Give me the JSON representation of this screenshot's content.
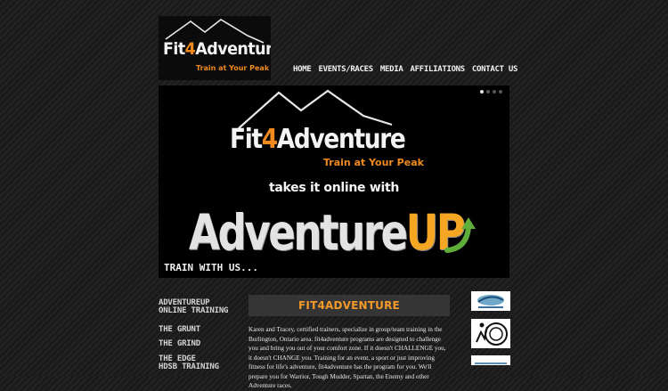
{
  "logo": {
    "part1": "Fit",
    "num": "4",
    "part2": "Adventure",
    "tagline": "Train at Your Peak"
  },
  "nav": [
    "HOME",
    "EVENTS/RACES",
    "MEDIA",
    "AFFILIATIONS",
    "CONTACT US"
  ],
  "banner": {
    "name_part1": "Fit",
    "name_num": "4",
    "name_part2": "Adventure",
    "tagline": "Train at Your Peak",
    "online_text": "takes it online with",
    "big_part1": "Adventure",
    "big_part2": "UP",
    "train_text": "TRAIN WITH US..."
  },
  "sidebar": [
    {
      "line1": "ADVENTUREUP",
      "line2": "ONLINE TRAINING"
    },
    {
      "line1": "THE GRUNT"
    },
    {
      "line1": "THE GRIND"
    },
    {
      "line1": "THE EDGE",
      "line2": "HDSB TRAINING"
    }
  ],
  "content": {
    "heading": "FIT4ADVENTURE",
    "body": "Karen and Tracey, certified trainers, specialize in group/team training in the Burlington, Ontario area. fit4adventure programs are designed to challenge you and bring you out of your comfort zone. If it doesn't CHALLENGE you, it doesn't CHANGE you. Training for an event, a sport or just improving fitness for life's adventure, fit4adventure has the program for you. We'll prepare you for Warrior, Tough Mudder, Spartan, the Enemy and other Adventure races."
  },
  "colors": {
    "accent": "#f08a1e",
    "background": "#1e1e1e"
  }
}
